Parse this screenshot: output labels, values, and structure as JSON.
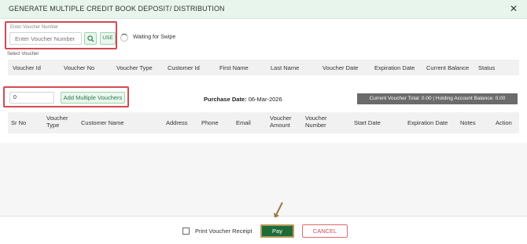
{
  "header": {
    "title": "GENERATE MULTIPLE CREDIT BOOK DEPOSIT/ DISTRIBUTION",
    "close_icon": "close-icon",
    "close_glyph": "✕"
  },
  "voucher": {
    "field_label": "Enter Voucher Number",
    "placeholder": "Enter Voucher Number",
    "value": "",
    "search_icon": "search-icon",
    "use_label": "USE",
    "swipe_text": "Waiting for Swipe"
  },
  "select_voucher_label": "Select Voucher",
  "table1": {
    "columns": [
      "Voucher Id",
      "Voucher No",
      "Voucher Type",
      "Customer Id",
      "First Name",
      "Last Name",
      "Voucher Date",
      "Expiration Date",
      "Current Balance",
      "Status"
    ]
  },
  "multi": {
    "quantity": "0",
    "add_label": "Add Multiple Vouchers",
    "purchase_label": "Purchase Date:",
    "purchase_date": "06-Mar-2026",
    "totals_text": "Current Voucher Total: 0.00  |  Holding Account Balance: 0.00"
  },
  "table2": {
    "columns": [
      "Sr No",
      "Voucher Type",
      "Customer Name",
      "Address",
      "Phone",
      "Email",
      "Voucher Amount",
      "Voucher Number",
      "Start Date",
      "Expiration Date",
      "Notes",
      "Action"
    ]
  },
  "footer": {
    "print_label": "Print Voucher Receipt",
    "print_checked": false,
    "pay_label": "Pay",
    "cancel_label": "CANCEL"
  },
  "colors": {
    "accent_green": "#1e6b3a",
    "highlight_red": "#d44a52",
    "header_bg": "#e8f5ec"
  }
}
